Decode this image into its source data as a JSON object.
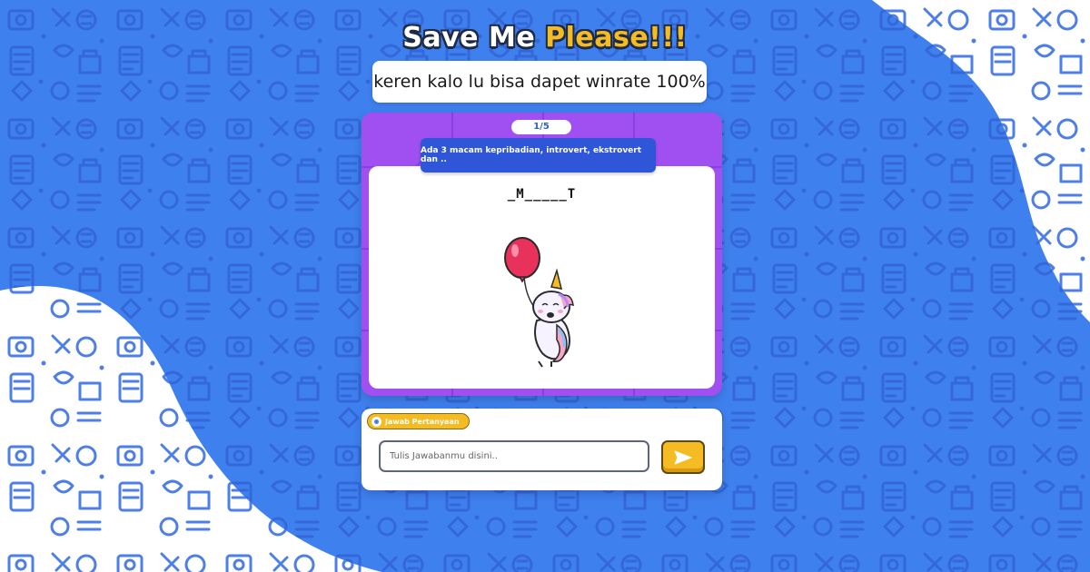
{
  "colors": {
    "background_blue": "#3f80ef",
    "accent_yellow": "#f5bb22",
    "board_purple": "#a04ff0",
    "question_blue": "#2f56d8"
  },
  "header": {
    "title_main": "Save Me ",
    "title_accent": "Please!!!",
    "subtitle": "keren kalo lu bisa dapet winrate 100%"
  },
  "game": {
    "progress": "1/5",
    "question": "Ada 3 macam kepribadian, introvert, ekstrovert dan ..",
    "hint": "_M_____T",
    "illustration": "unicorn-with-balloon"
  },
  "answer": {
    "tag_label": "Jawab Pertanyaan",
    "placeholder": "Tulis Jawabanmu disini..",
    "value": "",
    "submit_icon": "send-icon"
  }
}
